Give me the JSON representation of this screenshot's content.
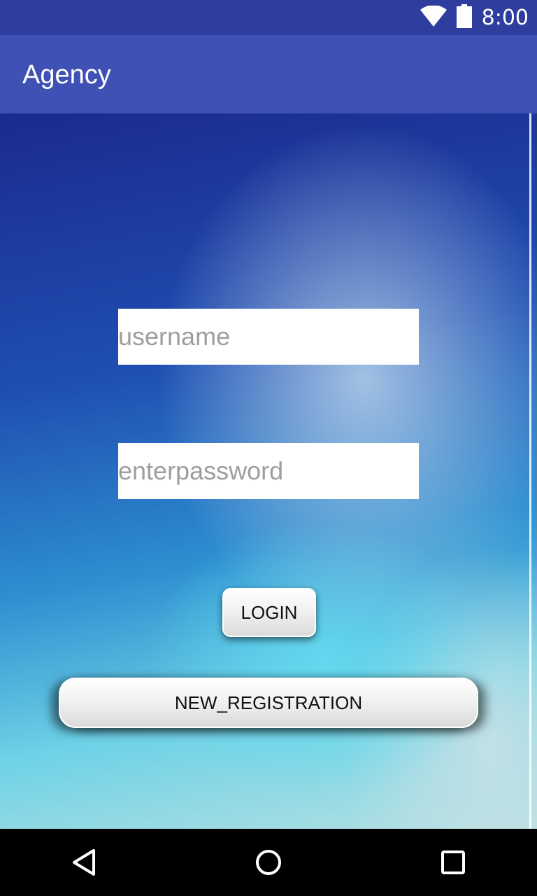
{
  "status_bar": {
    "time": "8:00",
    "wifi_icon": "wifi-icon",
    "battery_icon": "battery-icon"
  },
  "app_bar": {
    "title": "Agency"
  },
  "form": {
    "username_placeholder": "username",
    "password_placeholder": "enterpassword",
    "login_label": "LOGIN",
    "register_label": "NEW_REGISTRATION"
  },
  "nav_bar": {
    "back_icon": "back-icon",
    "home_icon": "home-icon",
    "recents_icon": "recents-icon"
  },
  "colors": {
    "status_bar": "#2f3e9e",
    "app_bar": "#3f51b5"
  }
}
